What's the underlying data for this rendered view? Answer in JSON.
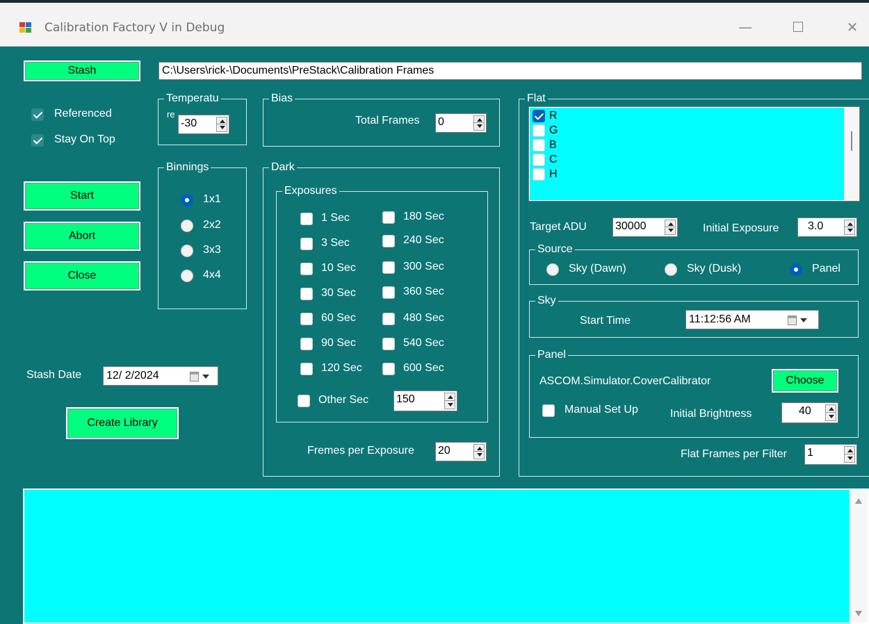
{
  "window": {
    "title": "Calibration Factory V  in Debug",
    "minimize_glyph": "—",
    "maximize_glyph": "☐",
    "close_glyph": "✕"
  },
  "left": {
    "stash_label": "Stash",
    "stash_path": "C:\\Users\\rick-\\Documents\\PreStack\\Calibration Frames",
    "referenced_label": "Referenced",
    "referenced_checked": true,
    "stay_on_top_label": "Stay On Top",
    "stay_on_top_checked": true,
    "start_label": "Start",
    "abort_label": "Abort",
    "close_label": "Close",
    "stash_date_label": "Stash Date",
    "stash_date_value": "12/ 2/2024",
    "create_library_label": "Create Library"
  },
  "temperature": {
    "title": "Temperatu",
    "title_wrap": "re",
    "value": "-30"
  },
  "binnings": {
    "title": "Binnings",
    "options": [
      "1x1",
      "2x2",
      "3x3",
      "4x4"
    ],
    "selected": "1x1"
  },
  "bias": {
    "title": "Bias",
    "total_frames_label": "Total Frames",
    "total_frames_value": "0"
  },
  "dark": {
    "title": "Dark",
    "exposures_title": "Exposures",
    "exposures_left": [
      "1 Sec",
      "3 Sec",
      "10 Sec",
      "30 Sec",
      "60 Sec",
      "90 Sec",
      "120 Sec"
    ],
    "exposures_right": [
      "180 Sec",
      "240 Sec",
      "300 Sec",
      "360 Sec",
      "480 Sec",
      "540 Sec",
      "600 Sec"
    ],
    "other_sec_label": "Other Sec",
    "other_sec_value": "150",
    "frames_per_exposure_label": "Fremes per Exposure",
    "frames_per_exposure_value": "20"
  },
  "flat": {
    "title": "Flat",
    "filters": [
      {
        "name": "R",
        "checked": true
      },
      {
        "name": "G",
        "checked": false
      },
      {
        "name": "B",
        "checked": false
      },
      {
        "name": "C",
        "checked": false
      },
      {
        "name": "H",
        "checked": false
      }
    ],
    "target_adu_label": "Target ADU",
    "target_adu_value": "30000",
    "initial_exposure_label": "Initial Exposure",
    "initial_exposure_value": "3.0",
    "source_title": "Source",
    "source_options": [
      "Sky (Dawn)",
      "Sky (Dusk)",
      "Panel"
    ],
    "source_selected": "Panel",
    "sky_title": "Sky",
    "start_time_label": "Start Time",
    "start_time_value": "11:12:56 AM",
    "panel_title": "Panel",
    "panel_device": "ASCOM.Simulator.CoverCalibrator",
    "choose_label": "Choose",
    "manual_setup_label": "Manual Set Up",
    "initial_brightness_label": "Initial Brightness",
    "initial_brightness_value": "40",
    "flat_frames_per_filter_label": "Flat Frames per Filter",
    "flat_frames_per_filter_value": "1"
  },
  "log": {
    "text": ""
  },
  "colors": {
    "background": "#0e7575",
    "button": "#00ff7f",
    "list_fill": "#00ffff",
    "check_blue": "#005fb8"
  }
}
